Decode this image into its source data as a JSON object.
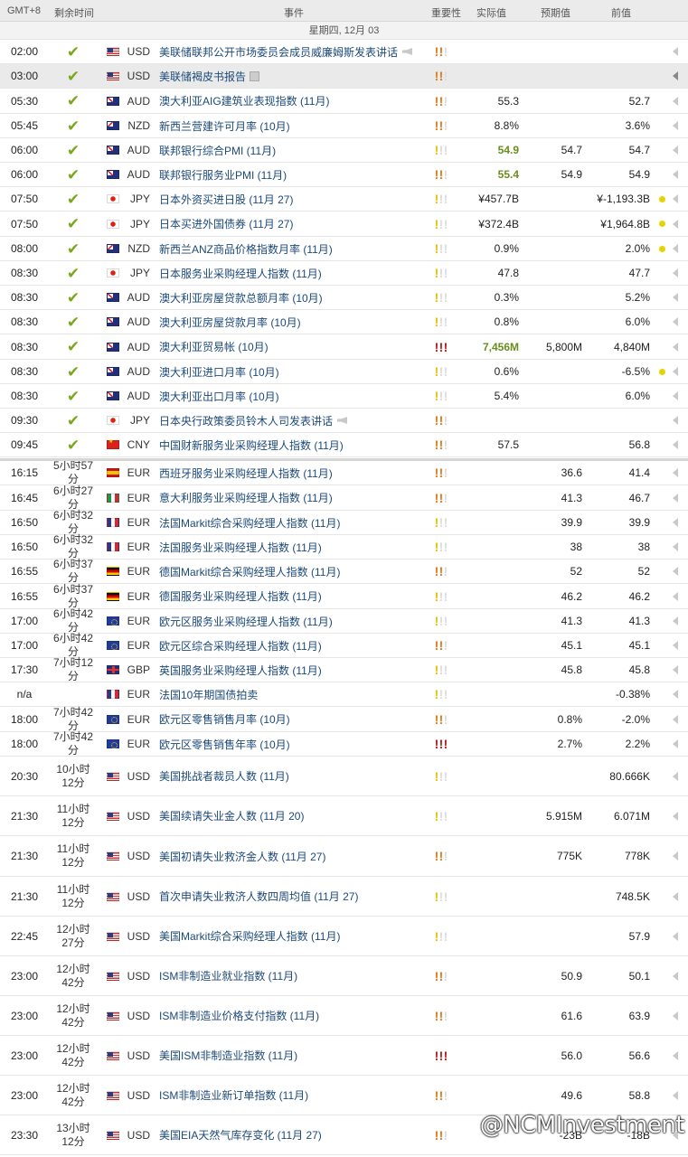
{
  "header": {
    "tz": "GMT+8",
    "remaining": "剩余时间",
    "event": "事件",
    "importance": "重要性",
    "actual": "实际值",
    "forecast": "预期值",
    "previous": "前值"
  },
  "day_label": "星期四, 12月 03",
  "watermark": "@NCMInvestment",
  "rows": [
    {
      "time": "02:00",
      "rem": "✔",
      "flag": "us",
      "cur": "USD",
      "event": "美联储联邦公开市场委员会成员威廉姆斯发表讲话",
      "icon": "speaker",
      "imp": "md",
      "act": "",
      "fc": "",
      "prev": "",
      "dot": false
    },
    {
      "time": "03:00",
      "rem": "✔",
      "flag": "us",
      "cur": "USD",
      "event": "美联储褐皮书报告",
      "icon": "doc",
      "imp": "md",
      "act": "",
      "fc": "",
      "prev": "",
      "dot": false,
      "hl": true
    },
    {
      "time": "05:30",
      "rem": "✔",
      "flag": "au",
      "cur": "AUD",
      "event": "澳大利亚AIG建筑业表现指数 (11月)",
      "imp": "md",
      "act": "55.3",
      "fc": "",
      "prev": "52.7",
      "dot": false
    },
    {
      "time": "05:45",
      "rem": "✔",
      "flag": "nz",
      "cur": "NZD",
      "event": "新西兰营建许可月率 (10月)",
      "imp": "md",
      "act": "8.8%",
      "fc": "",
      "prev": "3.6%",
      "dot": false
    },
    {
      "time": "06:00",
      "rem": "✔",
      "flag": "au",
      "cur": "AUD",
      "event": "联邦银行综合PMI (11月)",
      "imp": "lo",
      "act": "54.9",
      "good": true,
      "fc": "54.7",
      "prev": "54.7",
      "dot": false
    },
    {
      "time": "06:00",
      "rem": "✔",
      "flag": "au",
      "cur": "AUD",
      "event": "联邦银行服务业PMI (11月)",
      "imp": "md",
      "act": "55.4",
      "good": true,
      "fc": "54.9",
      "prev": "54.9",
      "dot": false
    },
    {
      "time": "07:50",
      "rem": "✔",
      "flag": "jp",
      "cur": "JPY",
      "event": "日本外资买进日股 (11月 27)",
      "imp": "lo",
      "act": "¥457.7B",
      "fc": "",
      "prev": "¥-1,193.3B",
      "dot": true
    },
    {
      "time": "07:50",
      "rem": "✔",
      "flag": "jp",
      "cur": "JPY",
      "event": "日本买进外国债券 (11月 27)",
      "imp": "lo",
      "act": "¥372.4B",
      "fc": "",
      "prev": "¥1,964.8B",
      "dot": true
    },
    {
      "time": "08:00",
      "rem": "✔",
      "flag": "nz",
      "cur": "NZD",
      "event": "新西兰ANZ商品价格指数月率 (11月)",
      "imp": "lo",
      "act": "0.9%",
      "fc": "",
      "prev": "2.0%",
      "dot": true
    },
    {
      "time": "08:30",
      "rem": "✔",
      "flag": "jp",
      "cur": "JPY",
      "event": "日本服务业采购经理人指数 (11月)",
      "imp": "lo",
      "act": "47.8",
      "fc": "",
      "prev": "47.7",
      "dot": false
    },
    {
      "time": "08:30",
      "rem": "✔",
      "flag": "au",
      "cur": "AUD",
      "event": "澳大利亚房屋贷款总额月率 (10月)",
      "imp": "lo",
      "act": "0.3%",
      "fc": "",
      "prev": "5.2%",
      "dot": false
    },
    {
      "time": "08:30",
      "rem": "✔",
      "flag": "au",
      "cur": "AUD",
      "event": "澳大利亚房屋贷款月率 (10月)",
      "imp": "lo",
      "act": "0.8%",
      "fc": "",
      "prev": "6.0%",
      "dot": false
    },
    {
      "time": "08:30",
      "rem": "✔",
      "flag": "au",
      "cur": "AUD",
      "event": "澳大利亚贸易帐 (10月)",
      "imp": "hi",
      "act": "7,456M",
      "good": true,
      "fc": "5,800M",
      "prev": "4,840M",
      "dot": false
    },
    {
      "time": "08:30",
      "rem": "✔",
      "flag": "au",
      "cur": "AUD",
      "event": "澳大利亚进口月率 (10月)",
      "imp": "lo",
      "act": "0.6%",
      "fc": "",
      "prev": "-6.5%",
      "dot": true
    },
    {
      "time": "08:30",
      "rem": "✔",
      "flag": "au",
      "cur": "AUD",
      "event": "澳大利亚出口月率 (10月)",
      "imp": "lo",
      "act": "5.4%",
      "fc": "",
      "prev": "6.0%",
      "dot": false
    },
    {
      "time": "09:30",
      "rem": "✔",
      "flag": "jp",
      "cur": "JPY",
      "event": "日本央行政策委员铃木人司发表讲话",
      "icon": "speaker",
      "imp": "md",
      "act": "",
      "fc": "",
      "prev": "",
      "dot": false
    },
    {
      "time": "09:45",
      "rem": "✔",
      "flag": "cn",
      "cur": "CNY",
      "event": "中国财新服务业采购经理人指数 (11月)",
      "imp": "md",
      "act": "57.5",
      "fc": "",
      "prev": "56.8",
      "dot": false
    },
    {
      "time": "16:15",
      "rem": "5小时57分",
      "flag": "es",
      "cur": "EUR",
      "event": "西班牙服务业采购经理人指数 (11月)",
      "imp": "md",
      "act": "",
      "fc": "36.6",
      "prev": "41.4",
      "dot": false
    },
    {
      "time": "16:45",
      "rem": "6小时27分",
      "flag": "it",
      "cur": "EUR",
      "event": "意大利服务业采购经理人指数 (11月)",
      "imp": "md",
      "act": "",
      "fc": "41.3",
      "prev": "46.7",
      "dot": false
    },
    {
      "time": "16:50",
      "rem": "6小时32分",
      "flag": "fr",
      "cur": "EUR",
      "event": "法国Markit综合采购经理人指数 (11月)",
      "imp": "lo",
      "act": "",
      "fc": "39.9",
      "prev": "39.9",
      "dot": false
    },
    {
      "time": "16:50",
      "rem": "6小时32分",
      "flag": "fr",
      "cur": "EUR",
      "event": "法国服务业采购经理人指数 (11月)",
      "imp": "lo",
      "act": "",
      "fc": "38",
      "prev": "38",
      "dot": false
    },
    {
      "time": "16:55",
      "rem": "6小时37分",
      "flag": "de",
      "cur": "EUR",
      "event": "德国Markit综合采购经理人指数 (11月)",
      "imp": "md",
      "act": "",
      "fc": "52",
      "prev": "52",
      "dot": false
    },
    {
      "time": "16:55",
      "rem": "6小时37分",
      "flag": "de",
      "cur": "EUR",
      "event": "德国服务业采购经理人指数 (11月)",
      "imp": "lo",
      "act": "",
      "fc": "46.2",
      "prev": "46.2",
      "dot": false
    },
    {
      "time": "17:00",
      "rem": "6小时42分",
      "flag": "eu",
      "cur": "EUR",
      "event": "欧元区服务业采购经理人指数 (11月)",
      "imp": "lo",
      "act": "",
      "fc": "41.3",
      "prev": "41.3",
      "dot": false
    },
    {
      "time": "17:00",
      "rem": "6小时42分",
      "flag": "eu",
      "cur": "EUR",
      "event": "欧元区综合采购经理人指数 (11月)",
      "imp": "md",
      "act": "",
      "fc": "45.1",
      "prev": "45.1",
      "dot": false
    },
    {
      "time": "17:30",
      "rem": "7小时12分",
      "flag": "gb",
      "cur": "GBP",
      "event": "英国服务业采购经理人指数 (11月)",
      "imp": "lo",
      "act": "",
      "fc": "45.8",
      "prev": "45.8",
      "dot": false
    },
    {
      "time": "n/a",
      "rem": "",
      "flag": "fr",
      "cur": "EUR",
      "event": "法国10年期国债拍卖",
      "imp": "lo",
      "act": "",
      "fc": "",
      "prev": "-0.38%",
      "dot": false
    },
    {
      "time": "18:00",
      "rem": "7小时42分",
      "flag": "eu",
      "cur": "EUR",
      "event": "欧元区零售销售月率 (10月)",
      "imp": "md",
      "act": "",
      "fc": "0.8%",
      "prev": "-2.0%",
      "dot": false
    },
    {
      "time": "18:00",
      "rem": "7小时42分",
      "flag": "eu",
      "cur": "EUR",
      "event": "欧元区零售销售年率 (10月)",
      "imp": "hi",
      "act": "",
      "fc": "2.7%",
      "prev": "2.2%",
      "dot": false
    },
    {
      "time": "20:30",
      "rem": "10小时12分",
      "flag": "us",
      "cur": "USD",
      "event": "美国挑战者裁员人数 (11月)",
      "imp": "lo",
      "act": "",
      "fc": "",
      "prev": "80.666K",
      "dot": false
    },
    {
      "time": "21:30",
      "rem": "11小时12分",
      "flag": "us",
      "cur": "USD",
      "event": "美国续请失业金人数 (11月 20)",
      "imp": "lo",
      "act": "",
      "fc": "5.915M",
      "prev": "6.071M",
      "dot": false
    },
    {
      "time": "21:30",
      "rem": "11小时12分",
      "flag": "us",
      "cur": "USD",
      "event": "美国初请失业救济金人数 (11月 27)",
      "imp": "md",
      "act": "",
      "fc": "775K",
      "prev": "778K",
      "dot": false
    },
    {
      "time": "21:30",
      "rem": "11小时12分",
      "flag": "us",
      "cur": "USD",
      "event": "首次申请失业救济人数四周均值 (11月 27)",
      "imp": "lo",
      "act": "",
      "fc": "",
      "prev": "748.5K",
      "dot": false
    },
    {
      "time": "22:45",
      "rem": "12小时27分",
      "flag": "us",
      "cur": "USD",
      "event": "美国Markit综合采购经理人指数 (11月)",
      "imp": "lo",
      "act": "",
      "fc": "",
      "prev": "57.9",
      "dot": false
    },
    {
      "time": "23:00",
      "rem": "12小时42分",
      "flag": "us",
      "cur": "USD",
      "event": "ISM非制造业就业指数 (11月)",
      "imp": "md",
      "act": "",
      "fc": "50.9",
      "prev": "50.1",
      "dot": false
    },
    {
      "time": "23:00",
      "rem": "12小时42分",
      "flag": "us",
      "cur": "USD",
      "event": "ISM非制造业价格支付指数 (11月)",
      "imp": "md",
      "act": "",
      "fc": "61.6",
      "prev": "63.9",
      "dot": false
    },
    {
      "time": "23:00",
      "rem": "12小时42分",
      "flag": "us",
      "cur": "USD",
      "event": "美国ISM非制造业指数 (11月)",
      "imp": "hi",
      "act": "",
      "fc": "56.0",
      "prev": "56.6",
      "dot": false
    },
    {
      "time": "23:00",
      "rem": "12小时42分",
      "flag": "us",
      "cur": "USD",
      "event": "ISM非制造业新订单指数 (11月)",
      "imp": "md",
      "act": "",
      "fc": "49.6",
      "prev": "58.8",
      "dot": false
    },
    {
      "time": "23:30",
      "rem": "13小时12分",
      "flag": "us",
      "cur": "USD",
      "event": "美国EIA天然气库存变化 (11月 27)",
      "imp": "md",
      "act": "",
      "fc": "-23B",
      "prev": "-18B",
      "dot": false
    }
  ]
}
